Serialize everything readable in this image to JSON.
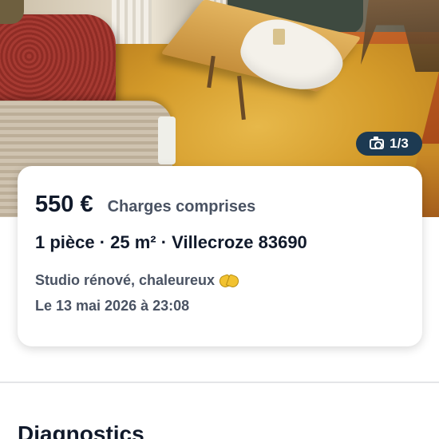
{
  "photo": {
    "counter": "1/3",
    "icon": "camera-icon"
  },
  "listing": {
    "price": "550 €",
    "charges": "Charges comprises",
    "specs": "1 pièce · 25 m² · Villecroze 83690",
    "title": "Studio rénové, chaleureux",
    "title_emoji_icon": "heart-hands-icon",
    "date": "Le 13 mai 2026 à 23:08"
  },
  "sections": {
    "diagnostics_title": "Diagnostics"
  },
  "colors": {
    "counter_bg": "#1d3a52",
    "text_primary": "#111a2b",
    "text_secondary": "#4a5363"
  }
}
